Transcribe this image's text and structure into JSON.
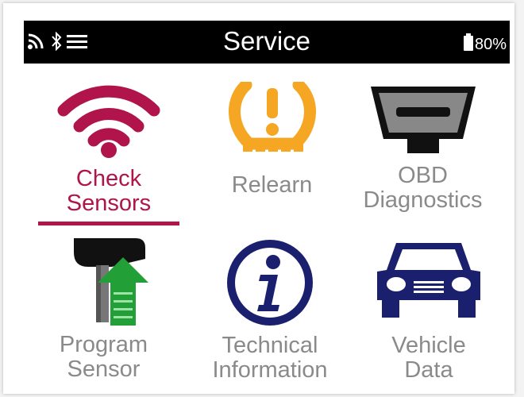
{
  "header": {
    "title": "Service",
    "battery_percent": "80%",
    "icons": [
      "signal-icon",
      "bluetooth-icon",
      "menu-icon",
      "battery-icon"
    ]
  },
  "colors": {
    "active": "#b0144a",
    "inactive": "#8a8a8a",
    "warning": "#f5a623",
    "navy": "#1a1f6e",
    "green": "#22a037",
    "bar": "#000000"
  },
  "tiles": [
    {
      "id": "check-sensors",
      "label": "Check\nSensors",
      "icon": "wireless-signal-icon",
      "active": true
    },
    {
      "id": "relearn",
      "label": "Relearn",
      "icon": "tire-pressure-warning-icon",
      "active": false
    },
    {
      "id": "obd-diagnostics",
      "label": "OBD\nDiagnostics",
      "icon": "obd-connector-icon",
      "active": false
    },
    {
      "id": "program-sensor",
      "label": "Program\nSensor",
      "icon": "sensor-program-icon",
      "active": false
    },
    {
      "id": "technical-information",
      "label": "Technical\nInformation",
      "icon": "info-icon",
      "active": false
    },
    {
      "id": "vehicle-data",
      "label": "Vehicle\nData",
      "icon": "car-icon",
      "active": false
    }
  ]
}
